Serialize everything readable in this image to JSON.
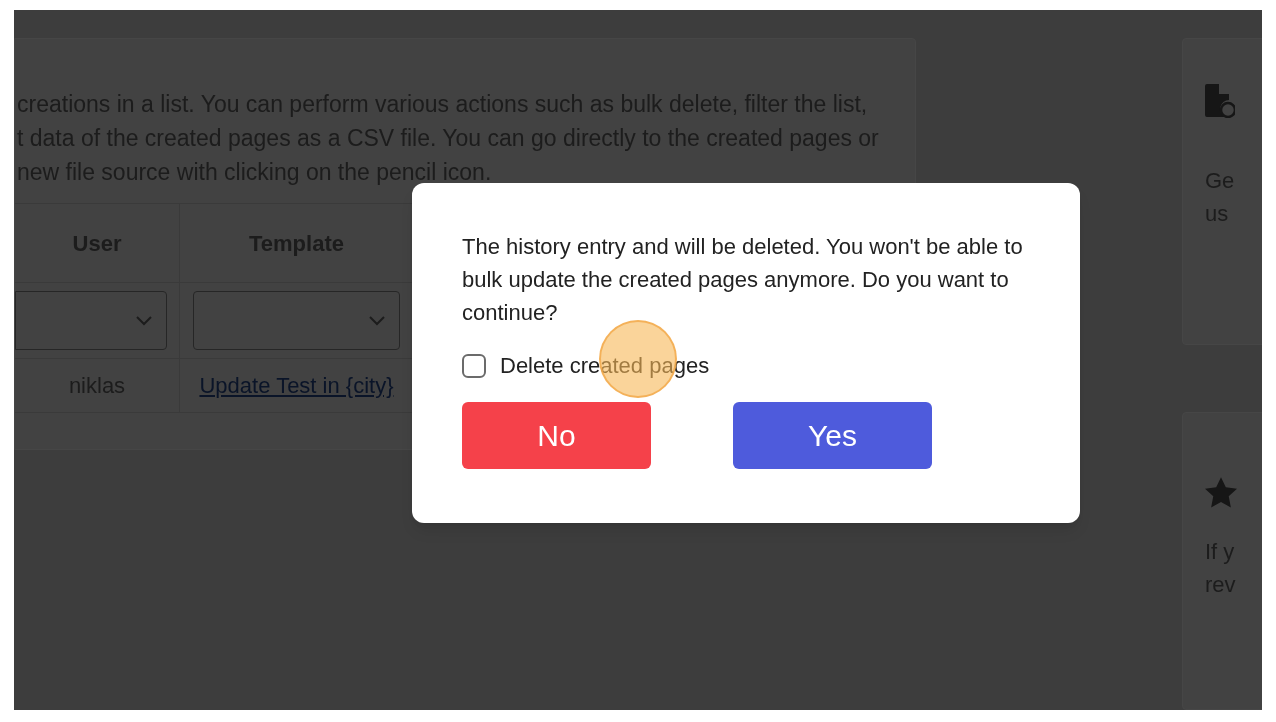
{
  "intro_lines": [
    "creations in a list. You can perform various actions such as bulk delete, filter the list,",
    "t data of the created pages as a CSV file. You can go directly to the created pages or",
    "new file source with clicking on the pencil icon."
  ],
  "table": {
    "columns": [
      "User",
      "Template"
    ],
    "rows": [
      {
        "cells": [
          {
            "kind": "text",
            "text": "niklas"
          },
          {
            "kind": "link",
            "text": "Update Test in {city}"
          }
        ]
      }
    ]
  },
  "side_cards": [
    {
      "kind": "document",
      "lines": [
        "Ge",
        "us"
      ]
    },
    {
      "kind": "star",
      "lines": [
        "If y",
        "rev"
      ]
    }
  ],
  "dialog": {
    "message": "The history entry and will be deleted. You won't be able to bulk update the created pages anymore. Do you want to continue?",
    "checkbox": {
      "label": "Delete created pages",
      "checked": false
    },
    "buttons": [
      {
        "label": "No",
        "kind": "cancel"
      },
      {
        "label": "Yes",
        "kind": "confirm"
      }
    ]
  }
}
